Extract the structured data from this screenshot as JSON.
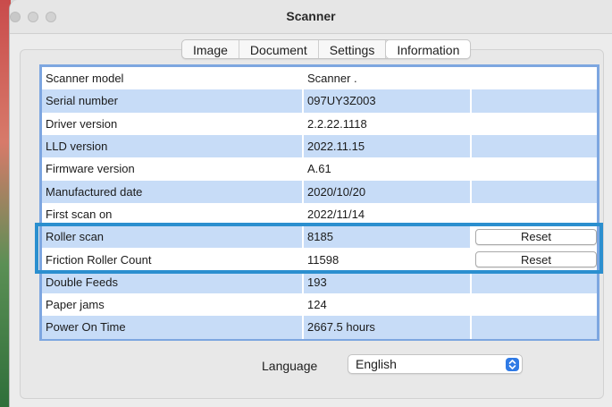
{
  "window": {
    "title": "Scanner"
  },
  "tabs": [
    {
      "label": "Image"
    },
    {
      "label": "Document"
    },
    {
      "label": "Settings"
    },
    {
      "label": "Information",
      "active": true
    }
  ],
  "table": {
    "rows": [
      {
        "label": "Scanner model",
        "value": "Scanner ."
      },
      {
        "label": "Serial number",
        "value": "097UY3Z003"
      },
      {
        "label": "Driver version",
        "value": "2.2.22.1118"
      },
      {
        "label": "LLD version",
        "value": "2022.11.15"
      },
      {
        "label": "Firmware version",
        "value": "A.61"
      },
      {
        "label": "Manufactured date",
        "value": "2020/10/20"
      },
      {
        "label": "First scan on",
        "value": "2022/11/14"
      },
      {
        "label": "Roller scan",
        "value": "8185",
        "action": "Reset"
      },
      {
        "label": "Friction Roller Count",
        "value": "11598",
        "action": "Reset"
      },
      {
        "label": "Double Feeds",
        "value": "193"
      },
      {
        "label": "Paper jams",
        "value": "124"
      },
      {
        "label": "Power On Time",
        "value": "2667.5 hours"
      }
    ]
  },
  "language": {
    "label": "Language",
    "selected": "English"
  },
  "colors": {
    "row_alt": "#c7dcf7",
    "table_border": "#7da6e0",
    "highlight_border": "#2b8fcf",
    "select_accent": "#2f7ae5"
  },
  "icons": {
    "select_arrows": "up-down-chevron-icon"
  }
}
